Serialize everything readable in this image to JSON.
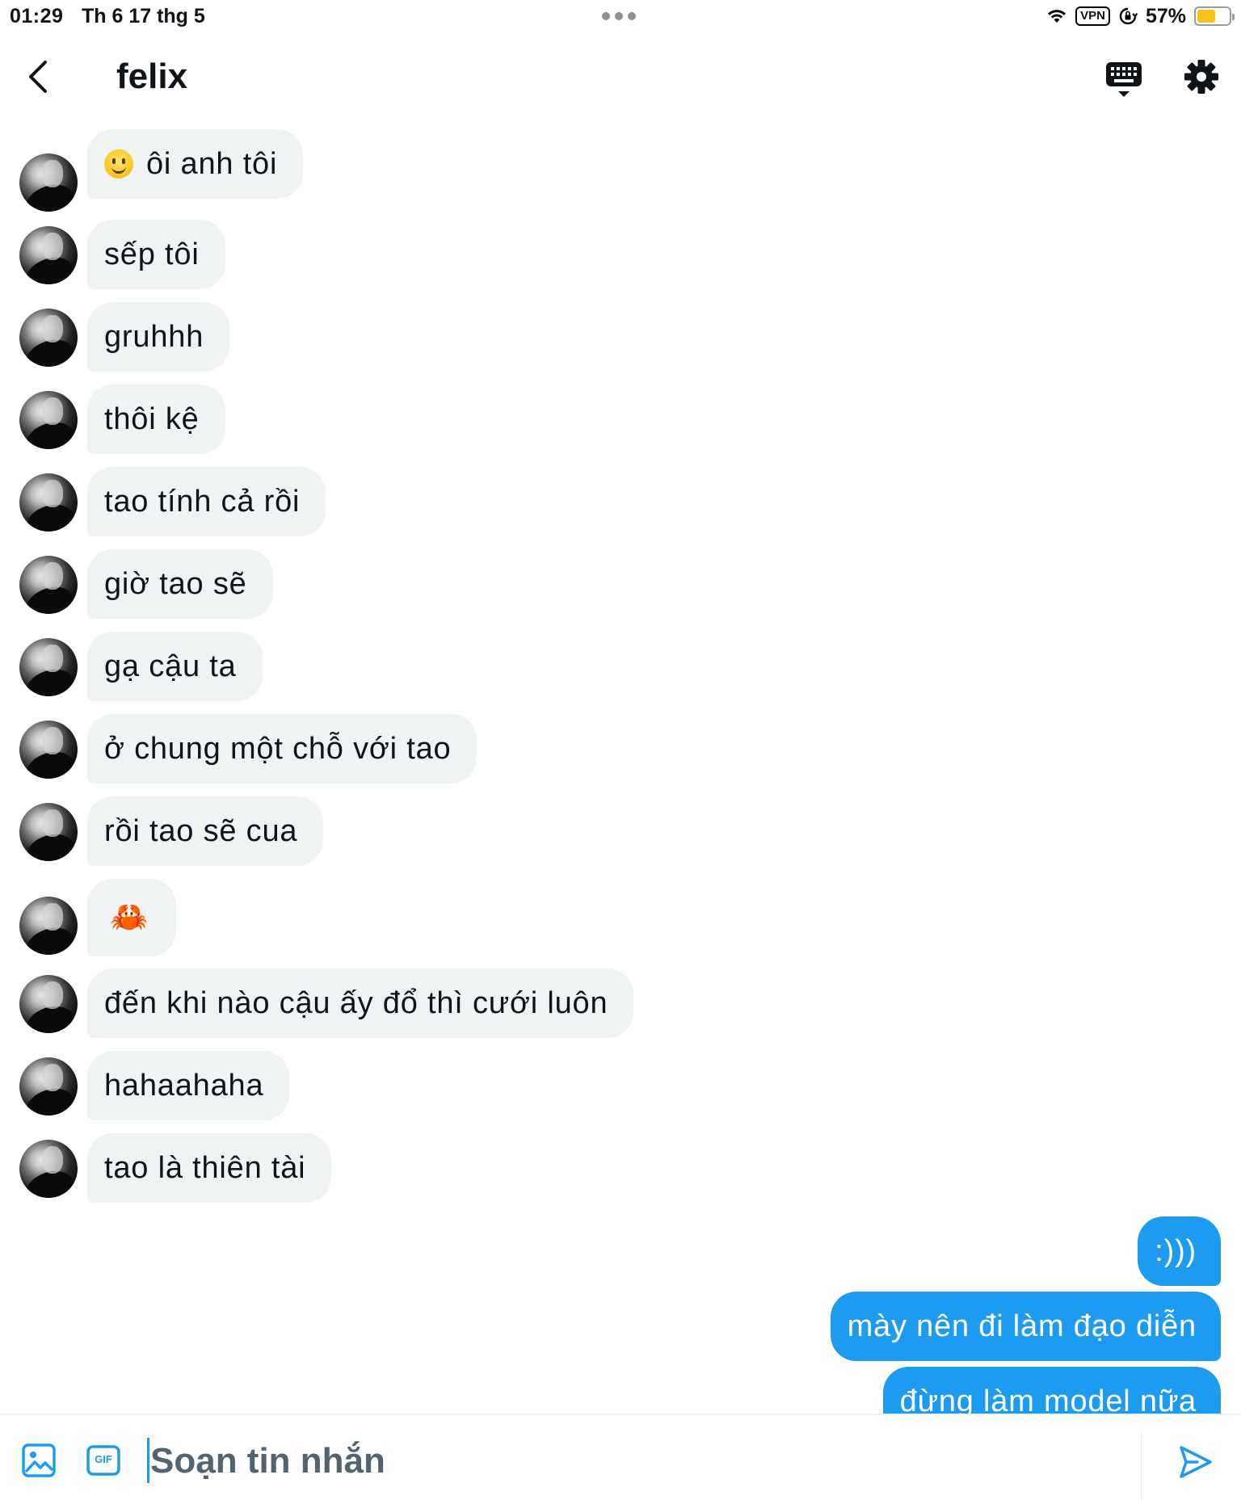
{
  "status_bar": {
    "time": "01:29",
    "date": "Th 6 17 thg 5",
    "vpn": "VPN",
    "battery_percent": "57%",
    "battery_level": 0.57,
    "battery_color": "#f5c417"
  },
  "header": {
    "title": "felix",
    "back_icon": "chevron-left-icon",
    "keyboard_icon": "keyboard-icon",
    "settings_icon": "gear-icon"
  },
  "messages_in": [
    {
      "text": "ôi anh tôi",
      "emoji": "slightly-smiling-face"
    },
    {
      "text": "sếp tôi"
    },
    {
      "text": "gruhhh"
    },
    {
      "text": "thôi kệ"
    },
    {
      "text": "tao tính cả rồi"
    },
    {
      "text": "giờ tao sẽ"
    },
    {
      "text": "gạ cậu ta"
    },
    {
      "text": "ở chung một chỗ với tao"
    },
    {
      "text": "rồi tao sẽ cua"
    },
    {
      "text": "🦀"
    },
    {
      "text": "đến khi nào cậu ấy đổ thì cưới luôn"
    },
    {
      "text": "hahaahaha"
    },
    {
      "text": "tao là thiên tài"
    }
  ],
  "messages_out": [
    {
      "text": ":)))"
    },
    {
      "text": "mày nên đi làm đạo diễn"
    },
    {
      "text": "đừng làm model nữa"
    }
  ],
  "composer": {
    "placeholder": "Soạn tin nhắn",
    "image_icon": "image-icon",
    "gif_label": "GIF",
    "send_icon": "send-icon"
  },
  "colors": {
    "accent": "#1d9bf0",
    "bubble_in": "#eff3f4",
    "text": "#0f1419"
  }
}
